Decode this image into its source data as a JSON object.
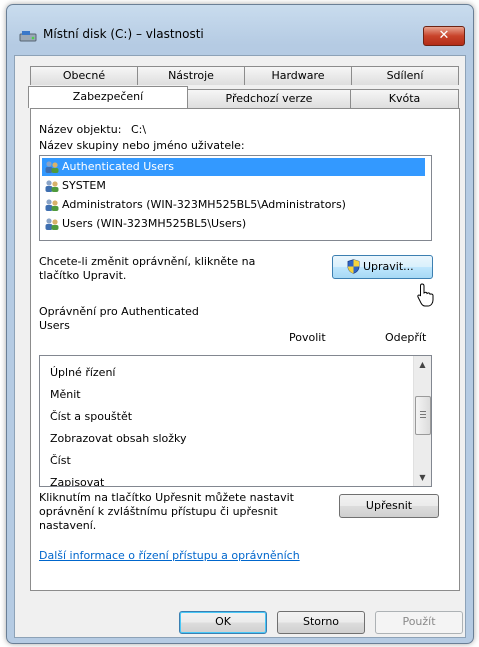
{
  "window": {
    "title": "Místní disk (C:) – vlastnosti",
    "close_glyph": "✕"
  },
  "tabs": {
    "row1": [
      "Obecné",
      "Nástroje",
      "Hardware",
      "Sdílení"
    ],
    "row2": [
      "Zabezpečení",
      "Předchozí verze",
      "Kvóta"
    ],
    "active": "Zabezpečení"
  },
  "security": {
    "object_label": "Název objektu:",
    "object_value": "C:\\",
    "groups_label": "Název skupiny nebo jméno uživatele:",
    "users": [
      {
        "name": "Authenticated Users",
        "selected": true
      },
      {
        "name": "SYSTEM",
        "selected": false
      },
      {
        "name": "Administrators (WIN-323MH525BL5\\Administrators)",
        "selected": false
      },
      {
        "name": "Users (WIN-323MH525BL5\\Users)",
        "selected": false
      }
    ],
    "change_text_line1": "Chcete-li změnit oprávnění, klikněte na",
    "change_text_line2": "tlačítko Upravit.",
    "edit_button": "Upravit...",
    "permissions_for_line1": "Oprávnění pro Authenticated",
    "permissions_for_line2": "Users",
    "col_allow": "Povolit",
    "col_deny": "Odepřít",
    "permissions": [
      "Úplné řízení",
      "Měnit",
      "Číst a spouštět",
      "Zobrazovat obsah složky",
      "Číst",
      "Zapisovat"
    ],
    "advanced_text_line1": "Kliknutím na tlačítko Upřesnit můžete nastavit",
    "advanced_text_line2": "oprávnění k zvláštnímu přístupu či upřesnit",
    "advanced_text_line3": "nastavení.",
    "advanced_button": "Upřesnit",
    "more_info_link": "Další informace o řízení přístupu a oprávněních"
  },
  "footer": {
    "ok": "OK",
    "cancel": "Storno",
    "apply": "Použít"
  },
  "colors": {
    "selection": "#3399ff",
    "link": "#0066cc",
    "close": "#c8432a"
  }
}
